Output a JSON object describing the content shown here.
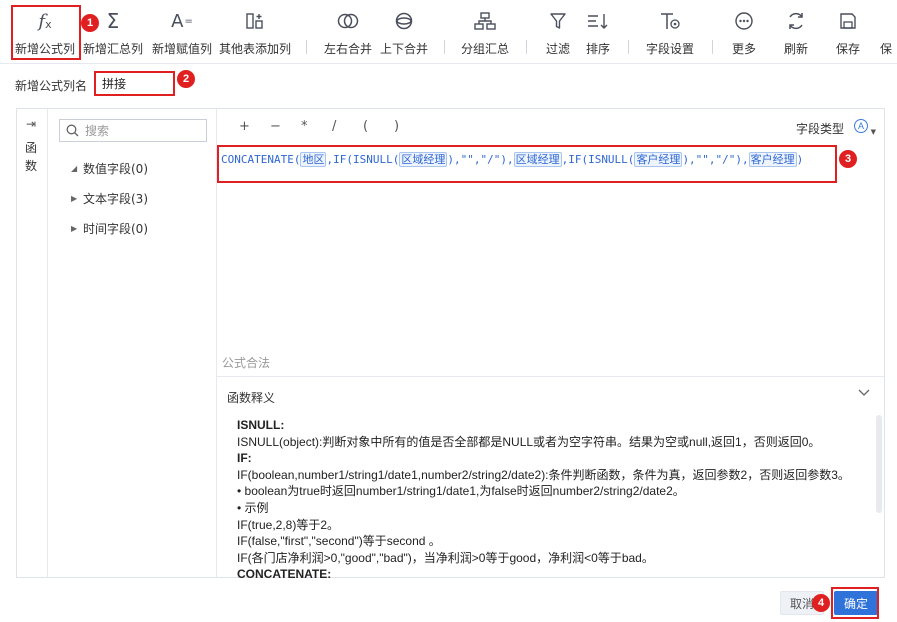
{
  "toolbar": {
    "items": [
      {
        "label": "新增公式列",
        "icon": "fx-icon"
      },
      {
        "label": "新增汇总列",
        "icon": "sigma-icon"
      },
      {
        "label": "新增赋值列",
        "icon": "assign-icon"
      },
      {
        "label": "其他表添加列",
        "icon": "add-table-column-icon"
      },
      {
        "label": "左右合并",
        "icon": "merge-horizontal-icon"
      },
      {
        "label": "上下合并",
        "icon": "merge-vertical-icon"
      },
      {
        "label": "分组汇总",
        "icon": "group-summary-icon"
      },
      {
        "label": "过滤",
        "icon": "filter-icon"
      },
      {
        "label": "排序",
        "icon": "sort-icon"
      },
      {
        "label": "字段设置",
        "icon": "field-settings-icon"
      },
      {
        "label": "更多",
        "icon": "more-icon"
      },
      {
        "label": "刷新",
        "icon": "refresh-icon"
      },
      {
        "label": "保存",
        "icon": "save-icon"
      },
      {
        "label": "保",
        "icon": "save-icon"
      }
    ]
  },
  "badges": [
    "1",
    "2",
    "3",
    "4"
  ],
  "name_row": {
    "label": "新增公式列名",
    "value": "拼接"
  },
  "side_tab": {
    "label": "函数"
  },
  "fields_panel": {
    "search_placeholder": "搜索",
    "groups": [
      "数值字段(0)",
      "文本字段(3)",
      "时间字段(0)"
    ]
  },
  "editor": {
    "operators": [
      "+",
      "−",
      "*",
      "/",
      "(",
      ")"
    ],
    "field_type_label": "字段类型",
    "field_type_icon": "A",
    "formula": {
      "p1": "CONCATENATE(",
      "f1": "地区",
      "p2": ",IF(ISNULL(",
      "f2": "区域经理",
      "p3": "),\"\",\"/\"),",
      "f3": "区域经理",
      "p4": ",IF(ISNULL(",
      "f4": "客户经理",
      "p5": "),\"\",\"/\"),",
      "f5": "客户经理",
      "p6": ")"
    },
    "validity": "公式合法"
  },
  "help": {
    "title": "函数释义",
    "lines": [
      {
        "text": "ISNULL:",
        "bold": true
      },
      {
        "text": "ISNULL(object):判断对象中所有的值是否全部都是NULL或者为空字符串。结果为空或null,返回1，否则返回0。",
        "bold": false
      },
      {
        "text": "IF:",
        "bold": true
      },
      {
        "text": "IF(boolean,number1/string1/date1,number2/string2/date2):条件判断函数，条件为真，返回参数2，否则返回参数3。",
        "bold": false
      },
      {
        "text": "• boolean为true时返回number1/string1/date1,为false时返回number2/string2/date2。",
        "bold": false
      },
      {
        "text": "• 示例",
        "bold": false
      },
      {
        "text": "IF(true,2,8)等于2。",
        "bold": false
      },
      {
        "text": "IF(false,\"first\",\"second\")等于second 。",
        "bold": false
      },
      {
        "text": "IF(各门店净利润>0,\"good\",\"bad\")，当净利润>0等于good，净利润<0等于bad。",
        "bold": false
      },
      {
        "text": "CONCATENATE:",
        "bold": true
      }
    ]
  },
  "footer": {
    "cancel": "取消",
    "ok": "确定"
  },
  "colors": {
    "accent": "#2f72d9",
    "annotation_red": "#e02020",
    "formula_blue": "#2f67d3"
  }
}
